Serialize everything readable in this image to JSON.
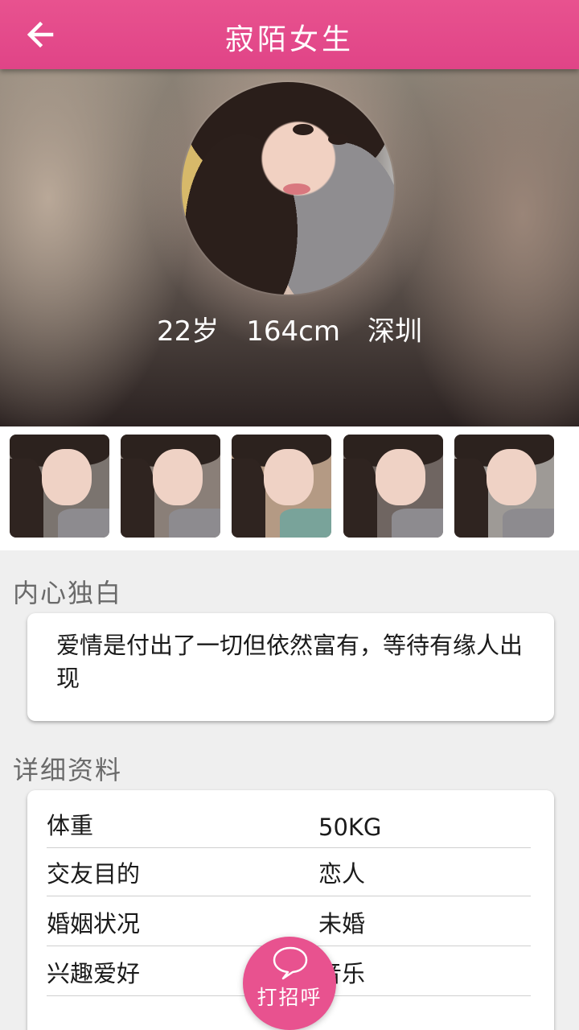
{
  "header": {
    "title": "寂陌女生",
    "back_icon": "arrow-left-icon"
  },
  "profile": {
    "age": "22岁",
    "height": "164cm",
    "city": "深圳"
  },
  "photos": [
    "photo-1",
    "photo-2",
    "photo-3",
    "photo-4",
    "photo-5"
  ],
  "monologue": {
    "label": "内心独白",
    "text": "爱情是付出了一切但依然富有，等待有缘人出现"
  },
  "details": {
    "label": "详细资料",
    "rows": [
      {
        "key": "体重",
        "value": "50KG"
      },
      {
        "key": "交友目的",
        "value": "恋人"
      },
      {
        "key": "婚姻状况",
        "value": "未婚"
      },
      {
        "key": "兴趣爱好",
        "value": "音乐"
      }
    ]
  },
  "greet_button": {
    "label": "打招呼",
    "icon": "speech-bubble-icon"
  },
  "colors": {
    "accent": "#e04487",
    "background": "#efefef"
  }
}
